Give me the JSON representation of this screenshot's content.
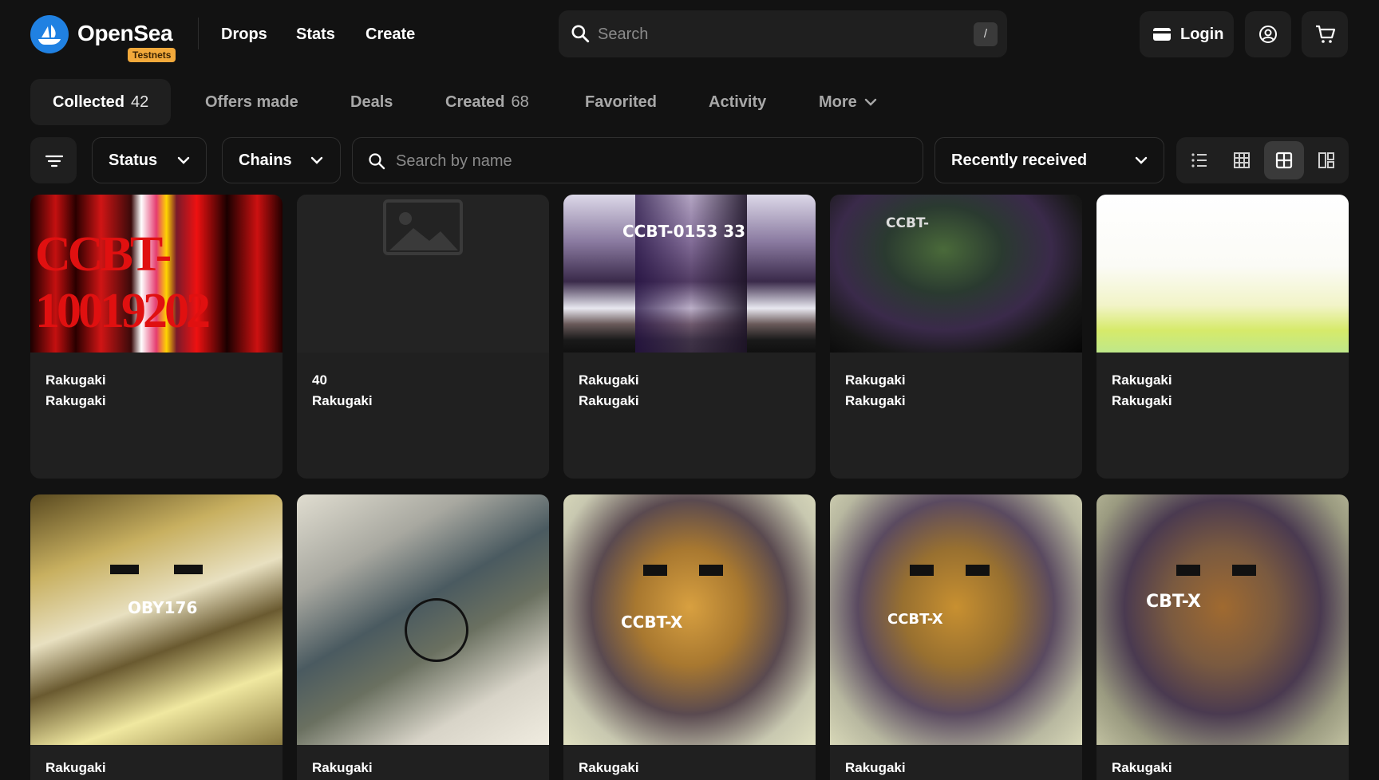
{
  "brand": {
    "name": "OpenSea",
    "badge": "Testnets"
  },
  "nav": {
    "drops": "Drops",
    "stats": "Stats",
    "create": "Create"
  },
  "search": {
    "placeholder": "Search",
    "shortcut": "/"
  },
  "header_actions": {
    "login": "Login"
  },
  "tabs": [
    {
      "label": "Collected",
      "count": "42"
    },
    {
      "label": "Offers made"
    },
    {
      "label": "Deals"
    },
    {
      "label": "Created",
      "count": "68"
    },
    {
      "label": "Favorited"
    },
    {
      "label": "Activity"
    },
    {
      "label": "More"
    }
  ],
  "filters": {
    "status": "Status",
    "chains": "Chains",
    "name_search_placeholder": "Search by name",
    "sort": "Recently received"
  },
  "cards": [
    {
      "name": "Rakugaki",
      "collection": "Rakugaki",
      "overlay": "CCBT-10019202"
    },
    {
      "name": "40",
      "collection": "Rakugaki"
    },
    {
      "name": "Rakugaki",
      "collection": "Rakugaki",
      "overlay": "CCBT-0153 33"
    },
    {
      "name": "Rakugaki",
      "collection": "Rakugaki",
      "overlay": "CCBT-"
    },
    {
      "name": "Rakugaki",
      "collection": "Rakugaki"
    },
    {
      "name": "Rakugaki",
      "overlay": "OBY176"
    },
    {
      "name": "Rakugaki"
    },
    {
      "name": "Rakugaki",
      "overlay": "CCBT-X"
    },
    {
      "name": "Rakugaki",
      "overlay": "CCBT-X"
    },
    {
      "name": "Rakugaki",
      "overlay": "CBT-X"
    }
  ],
  "colors": {
    "brand": "#2081e2",
    "badge": "#f2a93b",
    "background": "#121212",
    "surface": "#1f1f1f"
  }
}
